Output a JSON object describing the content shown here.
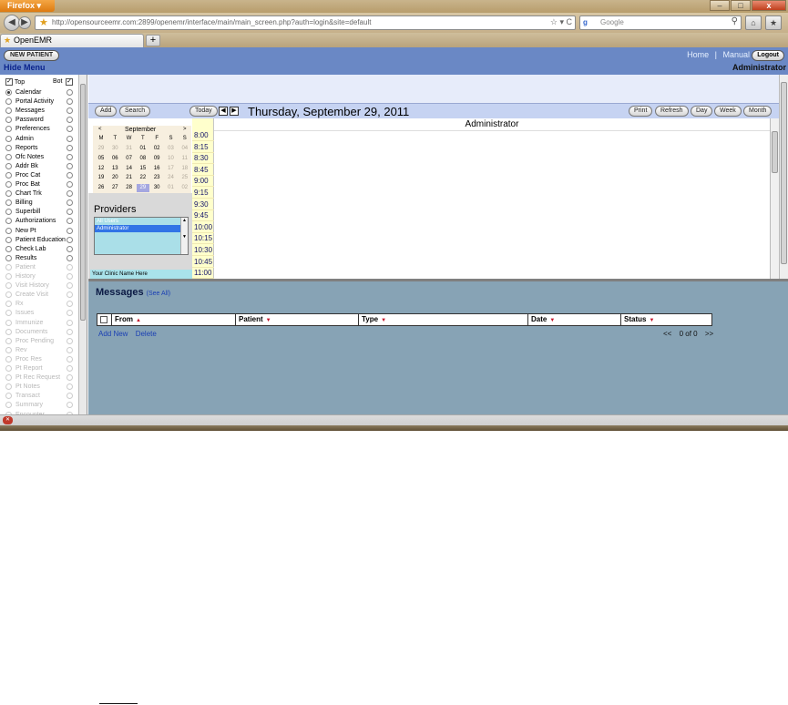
{
  "browser": {
    "menu_label": "Firefox",
    "url": "http://opensourceemr.com:2899/openemr/interface/main/main_screen.php?auth=login&site=default",
    "search_engine": "Google",
    "tab_title": "OpenEMR",
    "new_tab": "+",
    "window_controls": {
      "minimize": "–",
      "maximize": "□",
      "close": "x"
    },
    "nav": {
      "back": "◀",
      "forward": "▶",
      "reload": "C",
      "home": "⌂",
      "bookmarks": "★"
    }
  },
  "header": {
    "new_patient": "NEW PATIENT",
    "hide_menu": "Hide Menu",
    "home": "Home",
    "separator": "|",
    "manual": "Manual",
    "logout": "Logout",
    "user": "Administrator"
  },
  "left_nav": {
    "top_label": "Top",
    "bot_label": "Bot",
    "items": [
      {
        "label": "Calendar",
        "selected": true,
        "enabled": true
      },
      {
        "label": "Portal Activity",
        "enabled": true
      },
      {
        "label": "Messages",
        "enabled": true
      },
      {
        "label": "Password",
        "enabled": true
      },
      {
        "label": "Preferences",
        "enabled": true
      },
      {
        "label": "Admin",
        "enabled": true
      },
      {
        "label": "Reports",
        "enabled": true
      },
      {
        "label": "Ofc Notes",
        "enabled": true
      },
      {
        "label": "Addr Bk",
        "enabled": true
      },
      {
        "label": "Proc Cat",
        "enabled": true
      },
      {
        "label": "Proc Bat",
        "enabled": true
      },
      {
        "label": "Chart Trk",
        "enabled": true
      },
      {
        "label": "Billing",
        "enabled": true
      },
      {
        "label": "Superbill",
        "enabled": true
      },
      {
        "label": "Authorizations",
        "enabled": true
      },
      {
        "label": "New Pt",
        "enabled": true
      },
      {
        "label": "Patient Education",
        "enabled": true
      },
      {
        "label": "Check Lab",
        "enabled": true
      },
      {
        "label": "Results",
        "enabled": true
      },
      {
        "label": "Patient",
        "enabled": false
      },
      {
        "label": "History",
        "enabled": false
      },
      {
        "label": "Visit History",
        "enabled": false
      },
      {
        "label": "Create Visit",
        "enabled": false
      },
      {
        "label": "Rx",
        "enabled": false
      },
      {
        "label": "Issues",
        "enabled": false
      },
      {
        "label": "Immunize",
        "enabled": false
      },
      {
        "label": "Documents",
        "enabled": false
      },
      {
        "label": "Proc Pending",
        "enabled": false
      },
      {
        "label": "Rev",
        "enabled": false
      },
      {
        "label": "Proc Res",
        "enabled": false
      },
      {
        "label": "Pt Report",
        "enabled": false
      },
      {
        "label": "Pt Rec Request",
        "enabled": false
      },
      {
        "label": "Pt Notes",
        "enabled": false
      },
      {
        "label": "Transact",
        "enabled": false
      },
      {
        "label": "Summary",
        "enabled": false
      },
      {
        "label": "Encounter",
        "enabled": false
      }
    ]
  },
  "calendar": {
    "buttons": {
      "add": "Add",
      "search": "Search",
      "today": "Today",
      "prev": "◀",
      "next": "▶",
      "print": "Print",
      "refresh": "Refresh",
      "day": "Day",
      "week": "Week",
      "month": "Month"
    },
    "date_title": "Thursday, September 29, 2011",
    "mini": {
      "prev": "<",
      "next": ">",
      "month": "September",
      "dow": [
        "M",
        "T",
        "W",
        "T",
        "F",
        "S",
        "S"
      ],
      "weeks": [
        [
          "29",
          "30",
          "31",
          "01",
          "02",
          "03",
          "04"
        ],
        [
          "05",
          "06",
          "07",
          "08",
          "09",
          "10",
          "11"
        ],
        [
          "12",
          "13",
          "14",
          "15",
          "16",
          "17",
          "18"
        ],
        [
          "19",
          "20",
          "21",
          "22",
          "23",
          "24",
          "25"
        ],
        [
          "26",
          "27",
          "28",
          "29",
          "30",
          "01",
          "02"
        ]
      ]
    },
    "providers_title": "Providers",
    "providers": [
      "All Users",
      "Administrator"
    ],
    "clinic_name": "Your Clinic Name Here",
    "times": [
      "8:00",
      "8:15",
      "8:30",
      "8:45",
      "9:00",
      "9:15",
      "9:30",
      "9:45",
      "10:00",
      "10:15",
      "10:30",
      "10:45",
      "11:00"
    ],
    "column_header": "Administrator"
  },
  "messages": {
    "title": "Messages",
    "see_all": "(See All)",
    "columns": [
      "From",
      "Patient",
      "Type",
      "Date",
      "Status"
    ],
    "add_new": "Add New",
    "delete": "Delete",
    "pager_prev": "<<",
    "pager_text": "0 of 0",
    "pager_next": ">>"
  },
  "colors": {
    "header_bg": "#6a88c5",
    "messages_bg": "#87a3b5",
    "time_col_bg": "#ffffcc",
    "today_highlight": "#a5a7e0",
    "sort_arrow": "#c4142a"
  }
}
